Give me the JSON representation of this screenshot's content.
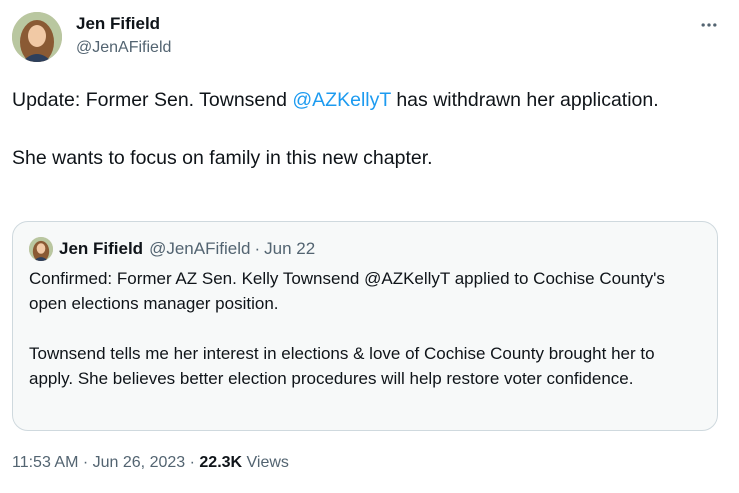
{
  "author": {
    "name": "Jen Fifield",
    "handle": "@JenAFifield"
  },
  "tweet": {
    "line1_before": "Update: Former Sen. Townsend ",
    "line1_mention": "@AZKellyT",
    "line1_after": " has withdrawn her application.",
    "line2": "She wants to focus on family in this new chapter."
  },
  "quote": {
    "name": "Jen Fifield",
    "handle": "@JenAFifield",
    "separator": "·",
    "date": "Jun 22",
    "para1": "Confirmed: Former AZ Sen. Kelly Townsend @AZKellyT applied to Cochise County's open elections manager position.",
    "para2": "Townsend tells me her interest in elections & love of Cochise County brought her to apply. She believes better election procedures will help restore voter confidence."
  },
  "meta": {
    "time": "11:53 AM",
    "sep1": " · ",
    "date": "Jun 26, 2023",
    "sep2": " · ",
    "views_count": "22.3K",
    "views_label": " Views"
  },
  "colors": {
    "link": "#1d9bf0",
    "secondary_text": "#536471",
    "border": "#cfd9de"
  },
  "icons": {
    "more": "more-horizontal-icon"
  }
}
